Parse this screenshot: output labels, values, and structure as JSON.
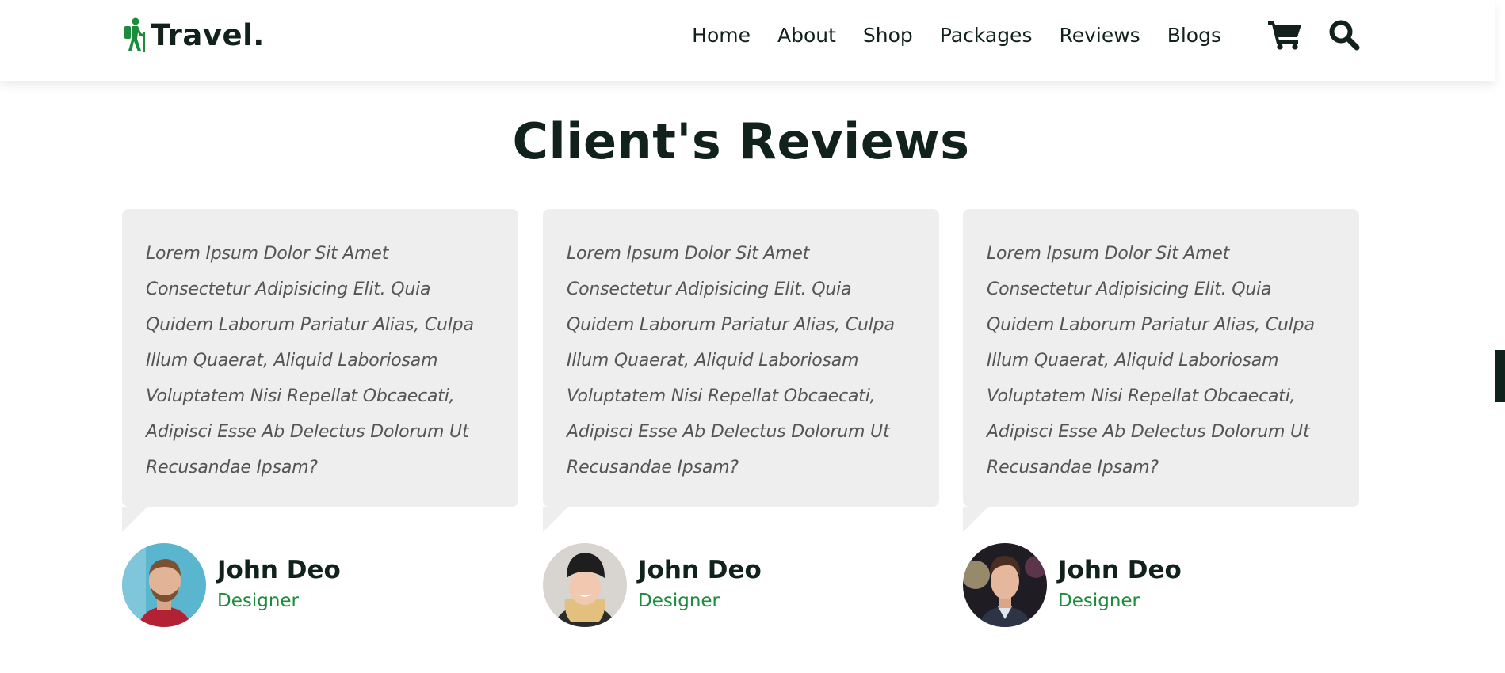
{
  "header": {
    "logo_text": "Travel.",
    "nav": [
      "Home",
      "About",
      "Shop",
      "Packages",
      "Reviews",
      "Blogs"
    ],
    "icons": [
      "shopping-cart-icon",
      "search-icon"
    ]
  },
  "section": {
    "title": "Client's Reviews"
  },
  "reviews": [
    {
      "text": "Lorem Ipsum Dolor Sit Amet Consectetur Adipisicing Elit. Quia Quidem Laborum Pariatur Alias, Culpa Illum Quaerat, Aliquid Laboriosam Voluptatem Nisi Repellat Obcaecati, Adipisci Esse Ab Delectus Dolorum Ut Recusandae Ipsam?",
      "name": "John Deo",
      "role": "Designer"
    },
    {
      "text": "Lorem Ipsum Dolor Sit Amet Consectetur Adipisicing Elit. Quia Quidem Laborum Pariatur Alias, Culpa Illum Quaerat, Aliquid Laboriosam Voluptatem Nisi Repellat Obcaecati, Adipisci Esse Ab Delectus Dolorum Ut Recusandae Ipsam?",
      "name": "John Deo",
      "role": "Designer"
    },
    {
      "text": "Lorem Ipsum Dolor Sit Amet Consectetur Adipisicing Elit. Quia Quidem Laborum Pariatur Alias, Culpa Illum Quaerat, Aliquid Laboriosam Voluptatem Nisi Repellat Obcaecati, Adipisci Esse Ab Delectus Dolorum Ut Recusandae Ipsam?",
      "name": "John Deo",
      "role": "Designer"
    }
  ],
  "colors": {
    "accent": "#1c8b3c",
    "dark": "#10221b",
    "card_bg": "#eeeeee"
  }
}
